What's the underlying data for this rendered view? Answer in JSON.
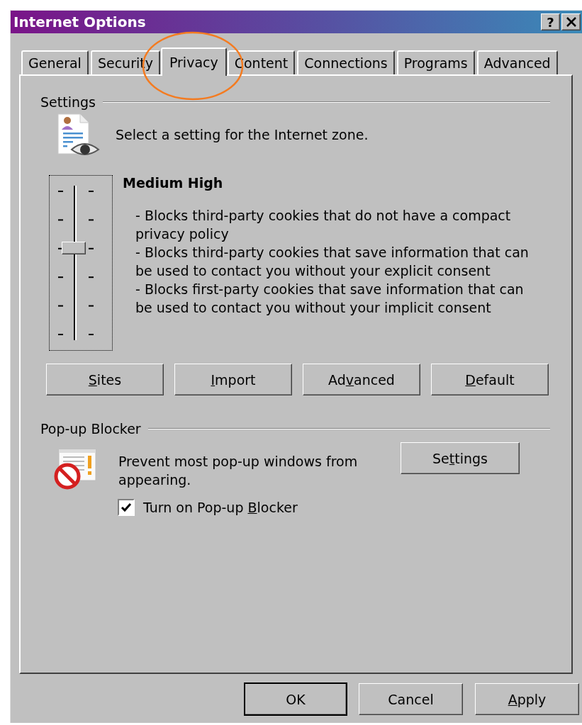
{
  "window": {
    "title": "Internet Options",
    "help_label": "?"
  },
  "tabs": [
    {
      "label": "General",
      "selected": false,
      "circled": false
    },
    {
      "label": "Security",
      "selected": false,
      "circled": false
    },
    {
      "label": "Privacy",
      "selected": true,
      "circled": true
    },
    {
      "label": "Content",
      "selected": false,
      "circled": false
    },
    {
      "label": "Connections",
      "selected": false,
      "circled": false
    },
    {
      "label": "Programs",
      "selected": false,
      "circled": false
    },
    {
      "label": "Advanced",
      "selected": false,
      "circled": false
    }
  ],
  "settings": {
    "heading": "Settings",
    "prompt": "Select a setting for the Internet zone.",
    "slider": {
      "level": 0.6
    },
    "level_name": "Medium High",
    "description": [
      "- Blocks third-party cookies that do not have a compact privacy policy",
      "- Blocks third-party cookies that save information that can be used to contact you without your explicit consent",
      "- Blocks first-party cookies that save information that can be used to contact you without your implicit consent"
    ],
    "buttons": [
      {
        "access_key": "S",
        "label_end": "ites"
      },
      {
        "access_key": "I",
        "label_end": "mport"
      },
      {
        "label_start": "Ad",
        "access_key": "v",
        "label_end": "anced"
      },
      {
        "access_key": "D",
        "label_end": "efault"
      }
    ]
  },
  "popup_blocker": {
    "heading": "Pop-up Blocker",
    "text": "Prevent most pop-up windows from appearing.",
    "settings_button": {
      "label_start": "Se",
      "access_key": "t",
      "label_end": "tings"
    },
    "checkbox": {
      "label_start": "Turn on Pop-up ",
      "access_key": "B",
      "label_end": "locker",
      "checked": true
    }
  },
  "footer_buttons": [
    {
      "label_start": "OK",
      "default": true
    },
    {
      "label_start": "Cancel",
      "default": false
    },
    {
      "access_key": "A",
      "label_end": "pply",
      "default": false
    }
  ]
}
